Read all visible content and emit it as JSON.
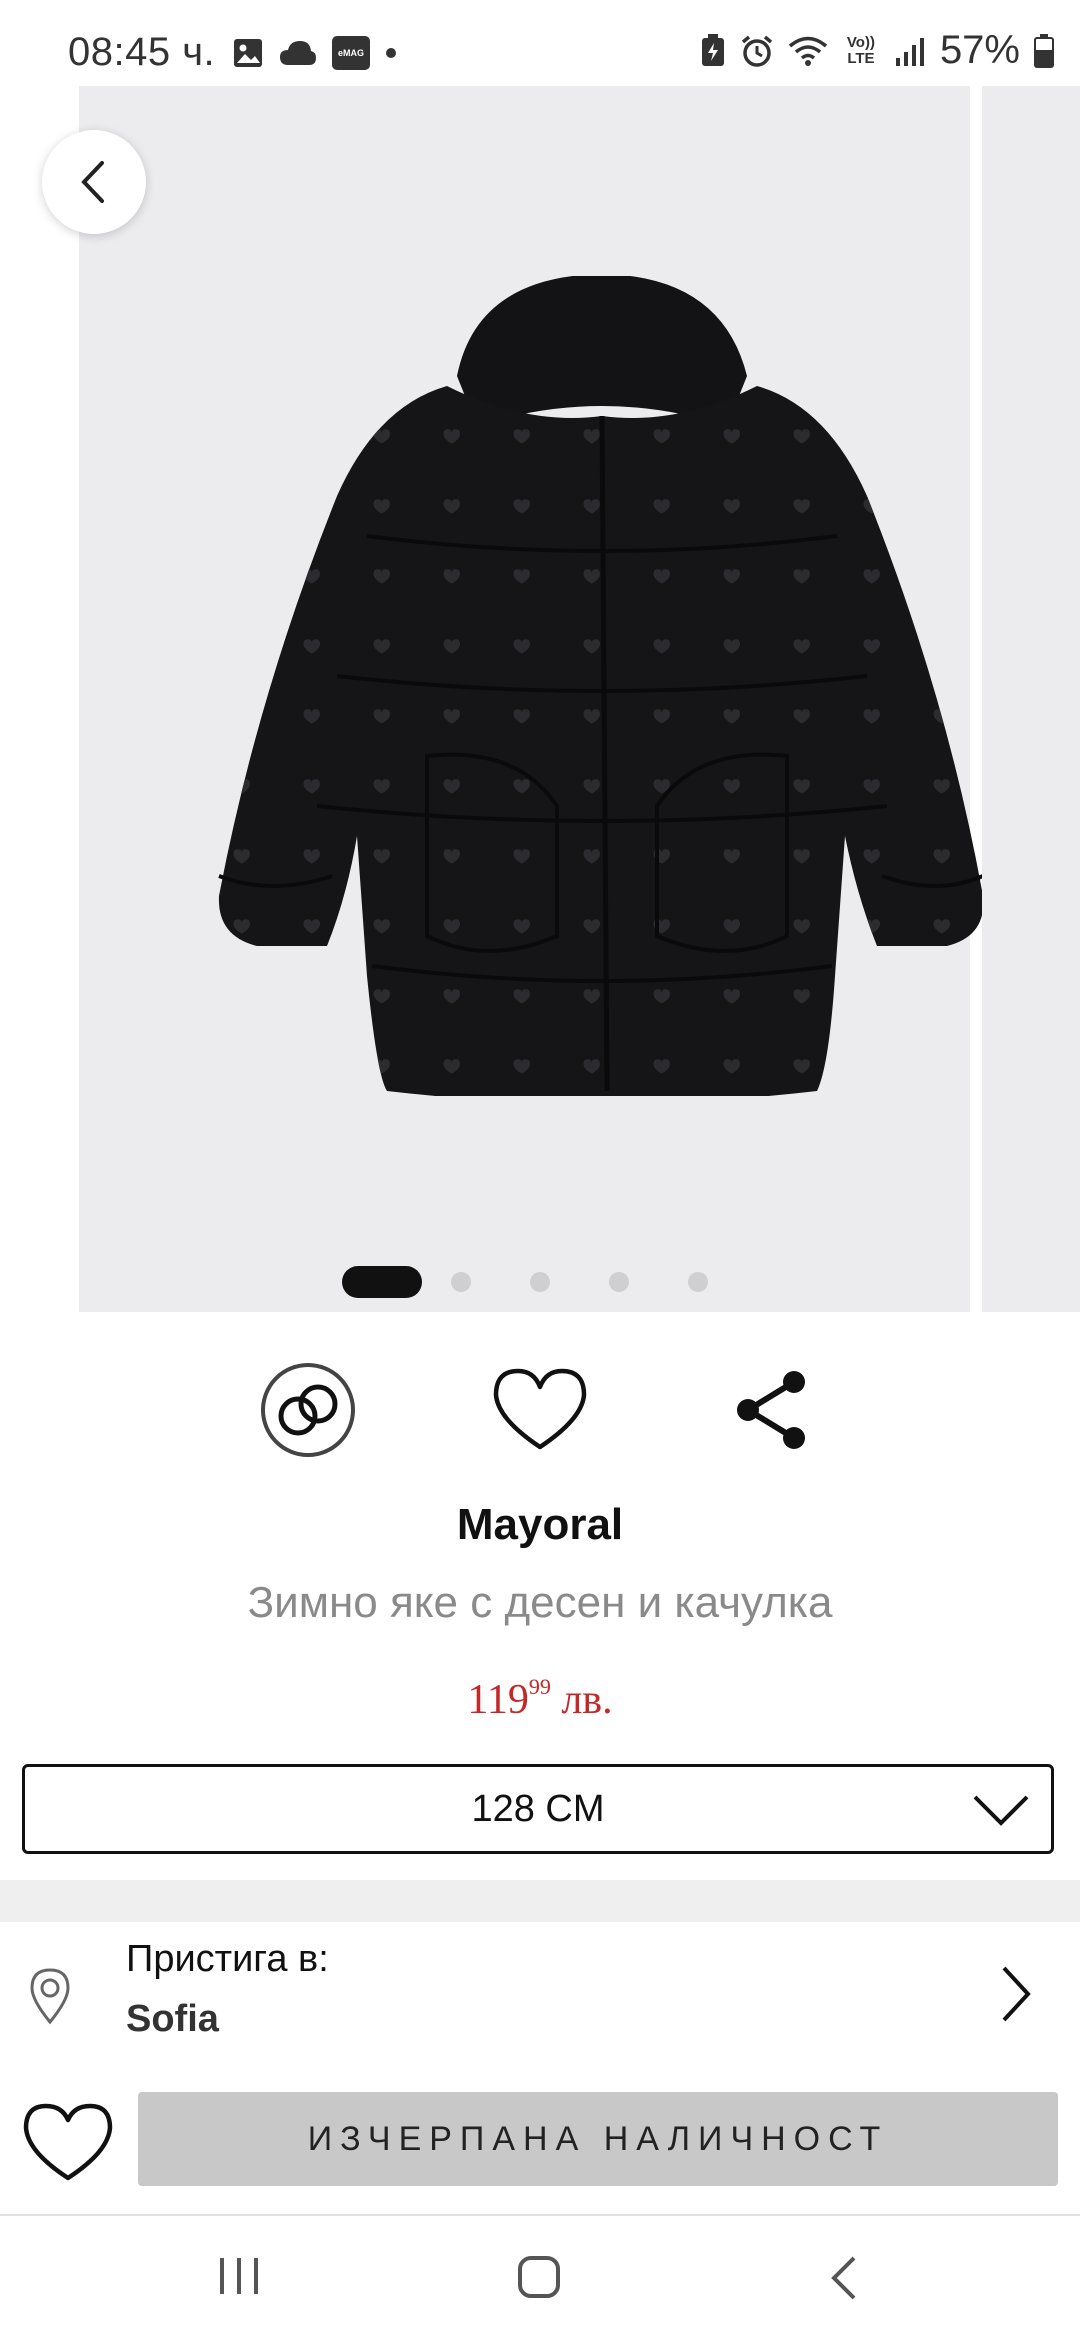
{
  "status_bar": {
    "time": "08:45 ч.",
    "battery_percent": "57%",
    "icons_left": [
      "gallery-icon",
      "cloud-icon",
      "emag-app-icon",
      "dot-icon"
    ],
    "icons_right": [
      "battery-saver-icon",
      "alarm-icon",
      "wifi-icon",
      "volte-icon",
      "signal-icon",
      "battery-icon"
    ],
    "emag_label": "eMAG",
    "volte_label": "Vo)) LTE"
  },
  "gallery": {
    "slide_count": 5,
    "active_index": 0,
    "image": "black-hooded-puffer-jacket-with-hearts"
  },
  "actions": {
    "compare": "compare-icon",
    "favorite": "heart-icon",
    "share": "share-icon"
  },
  "product": {
    "brand": "Mayoral",
    "name": "Зимно яке с десен и качулка",
    "price_main": "119",
    "price_cents": "99",
    "price_currency": " лв.",
    "price_color": "#c62828"
  },
  "size_selector": {
    "selected": "128 CM"
  },
  "delivery": {
    "label": "Пристига в:",
    "city": "Sofia"
  },
  "buy_bar": {
    "out_of_stock_label": "ИЗЧЕРПАНА НАЛИЧНОСТ"
  },
  "navigation": [
    "recent-apps-icon",
    "home-icon",
    "back-icon"
  ]
}
